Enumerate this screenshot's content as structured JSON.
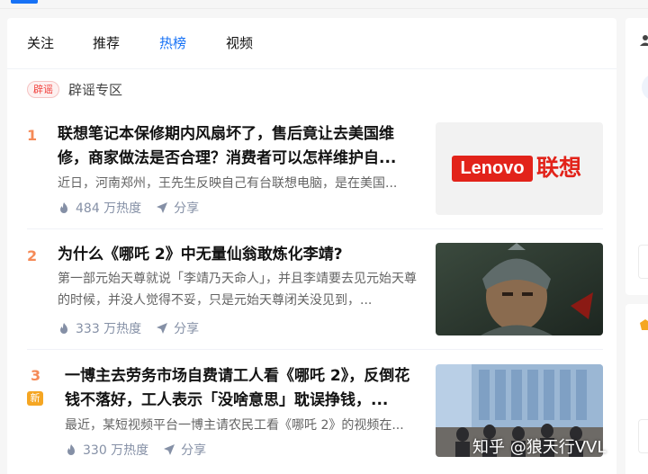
{
  "tabs": [
    {
      "label": "关注"
    },
    {
      "label": "推荐"
    },
    {
      "label": "热榜",
      "active": true
    },
    {
      "label": "视频"
    }
  ],
  "rumor": {
    "badge": "辟谣",
    "label": "辟谣专区"
  },
  "items": [
    {
      "rank": "1",
      "title": "联想笔记本保修期内风扇坏了，售后竟让去美国维修，商家做法是否合理？消费者可以怎样维护自...",
      "excerpt": "近日，河南郑州，王先生反映自己有台联想电脑，是在美国...",
      "heat": "484 万热度",
      "share": "分享",
      "thumb_text": {
        "brand_en": "Lenovo",
        "brand_cn": "联想"
      }
    },
    {
      "rank": "2",
      "title": "为什么《哪吒 2》中无量仙翁敢炼化李靖?",
      "excerpt": "第一部元始天尊就说「李靖乃天命人」，并且李靖要去见元始天尊的时候，并没人觉得不妥，只是元始天尊闭关没见到，...",
      "heat": "333 万热度",
      "share": "分享"
    },
    {
      "rank": "3",
      "badge": "新",
      "title": "一博主去劳务市场自费请工人看《哪吒 2》，反倒花钱不落好，工人表示「没啥意思」耽误挣钱，...",
      "excerpt": "最近，某短视频平台一博主请农民工看《哪吒 2》的视频在...",
      "heat": "330 万热度",
      "share": "分享"
    }
  ],
  "watermark": "知乎 @狼天行VVL",
  "colors": {
    "accent": "#1772f6",
    "rank": "#f58a57",
    "new_badge": "#f5a623",
    "lenovo_red": "#e2231a"
  }
}
